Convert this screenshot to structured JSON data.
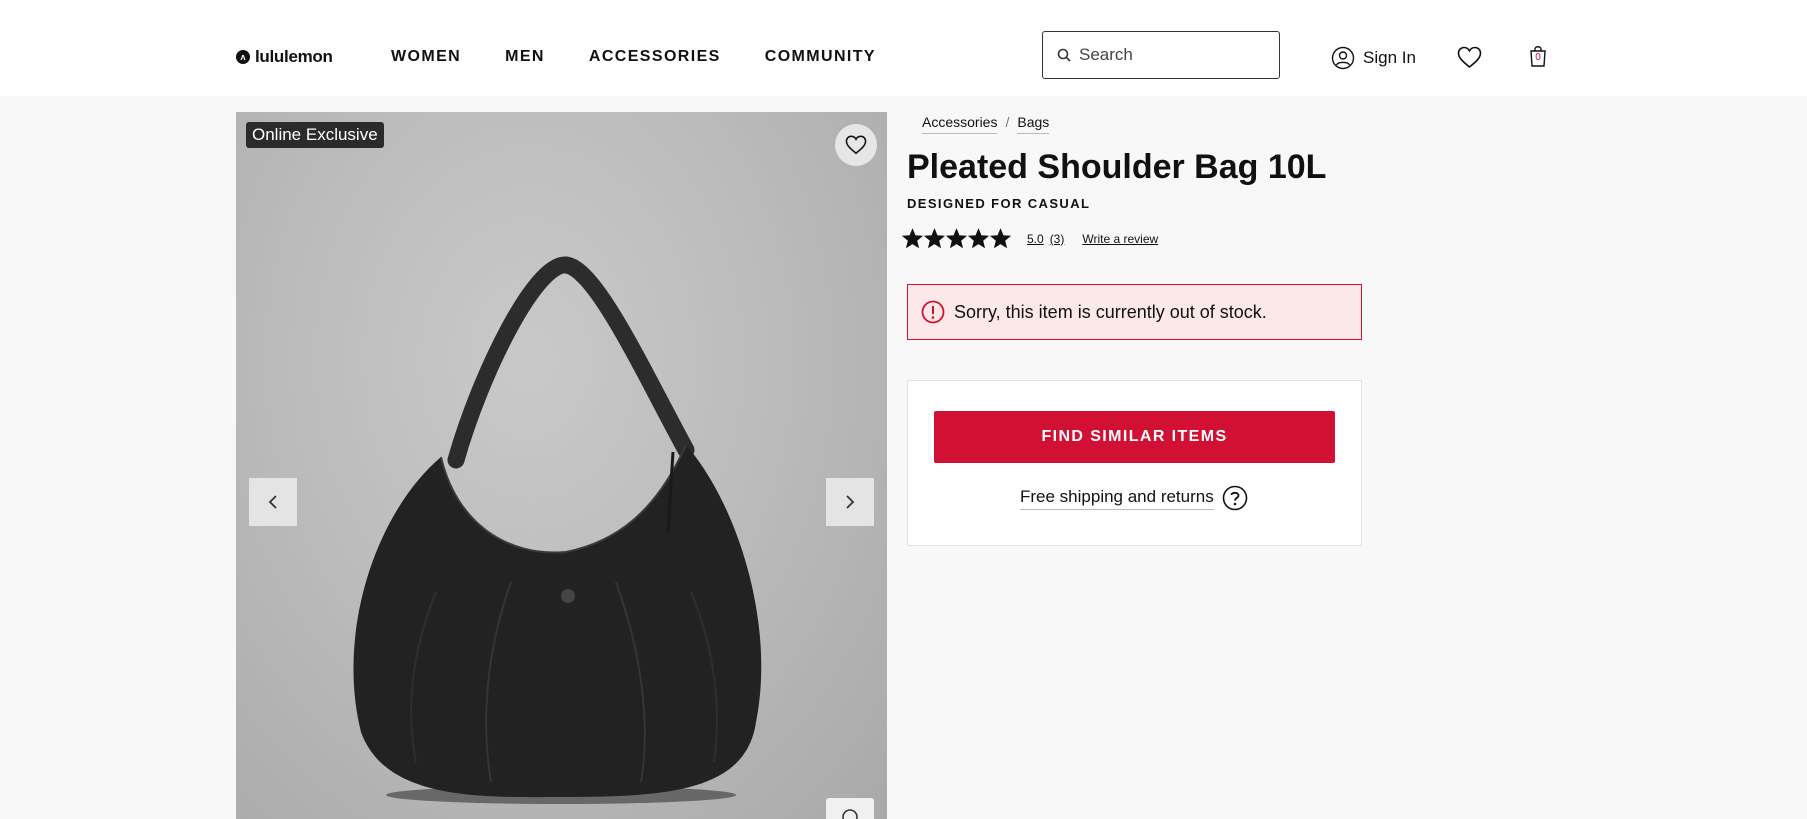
{
  "header": {
    "logo_text": "lululemon",
    "nav": [
      "WOMEN",
      "MEN",
      "ACCESSORIES",
      "COMMUNITY"
    ],
    "search_placeholder": "Search",
    "sign_in": "Sign In",
    "cart_count": "0"
  },
  "gallery": {
    "badge": "Online Exclusive"
  },
  "breadcrumb": [
    "Accessories",
    "Bags"
  ],
  "product": {
    "title": "Pleated Shoulder Bag 10L",
    "subtitle": "DESIGNED FOR CASUAL",
    "rating": 5.0,
    "rating_text": "5.0",
    "review_count": "(3)",
    "write_review": "Write a review",
    "stars_filled": 5,
    "stars_total": 5
  },
  "stock_alert": "Sorry, this item is currently out of stock.",
  "actions": {
    "find_similar": "FIND SIMILAR ITEMS",
    "shipping": "Free shipping and returns"
  },
  "colors": {
    "accent_red": "#d21034",
    "alert_bg": "#fde8e9",
    "page_bg": "#f8f8f8"
  }
}
